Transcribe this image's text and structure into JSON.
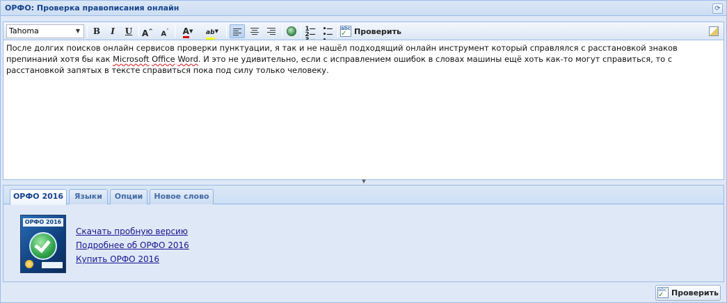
{
  "header": {
    "title": "ОРФО: Проверка правописания онлайн"
  },
  "toolbar": {
    "font_name": "Tahoma",
    "bold_label": "B",
    "italic_label": "I",
    "underline_label": "U",
    "grow_label": "A",
    "shrink_label": "A",
    "font_color_label": "A",
    "highlight_label": "ab",
    "check_label": "Проверить"
  },
  "editor": {
    "text_part1": "После долгих поисков онлайн сервисов проверки пунктуации, я так и не нашёл подходящий онлайн инструмент который справлялся с расстановкой знаков препинаний хотя бы как ",
    "misspelled_1": "Microsoft",
    "text_part2": " ",
    "misspelled_2": "Office",
    "text_part3": " ",
    "misspelled_3": "Word",
    "text_part4": ". И это не удивительно, если с исправлением ошибок в словах машины ещё хоть как-то могут справиться, то с расстановкой запятых в тексте справиться пока под силу только человеку."
  },
  "tabs": [
    {
      "label": "ОРФО 2016",
      "active": true
    },
    {
      "label": "Языки",
      "active": false
    },
    {
      "label": "Опции",
      "active": false
    },
    {
      "label": "Новое слово",
      "active": false
    }
  ],
  "product": {
    "box_brand": "ОРФО 2016",
    "links": [
      "Скачать пробную версию",
      "Подробнее об ОРФО 2016",
      "Купить ОРФО 2016"
    ]
  },
  "footer": {
    "check_button_label": "Проверить"
  },
  "colors": {
    "accent": "#15428b",
    "panel_bg": "#dfe8f6",
    "border": "#99bbe8",
    "font_color_indicator": "#d40000",
    "highlight_indicator": "#ffff00",
    "link": "#15158f"
  }
}
